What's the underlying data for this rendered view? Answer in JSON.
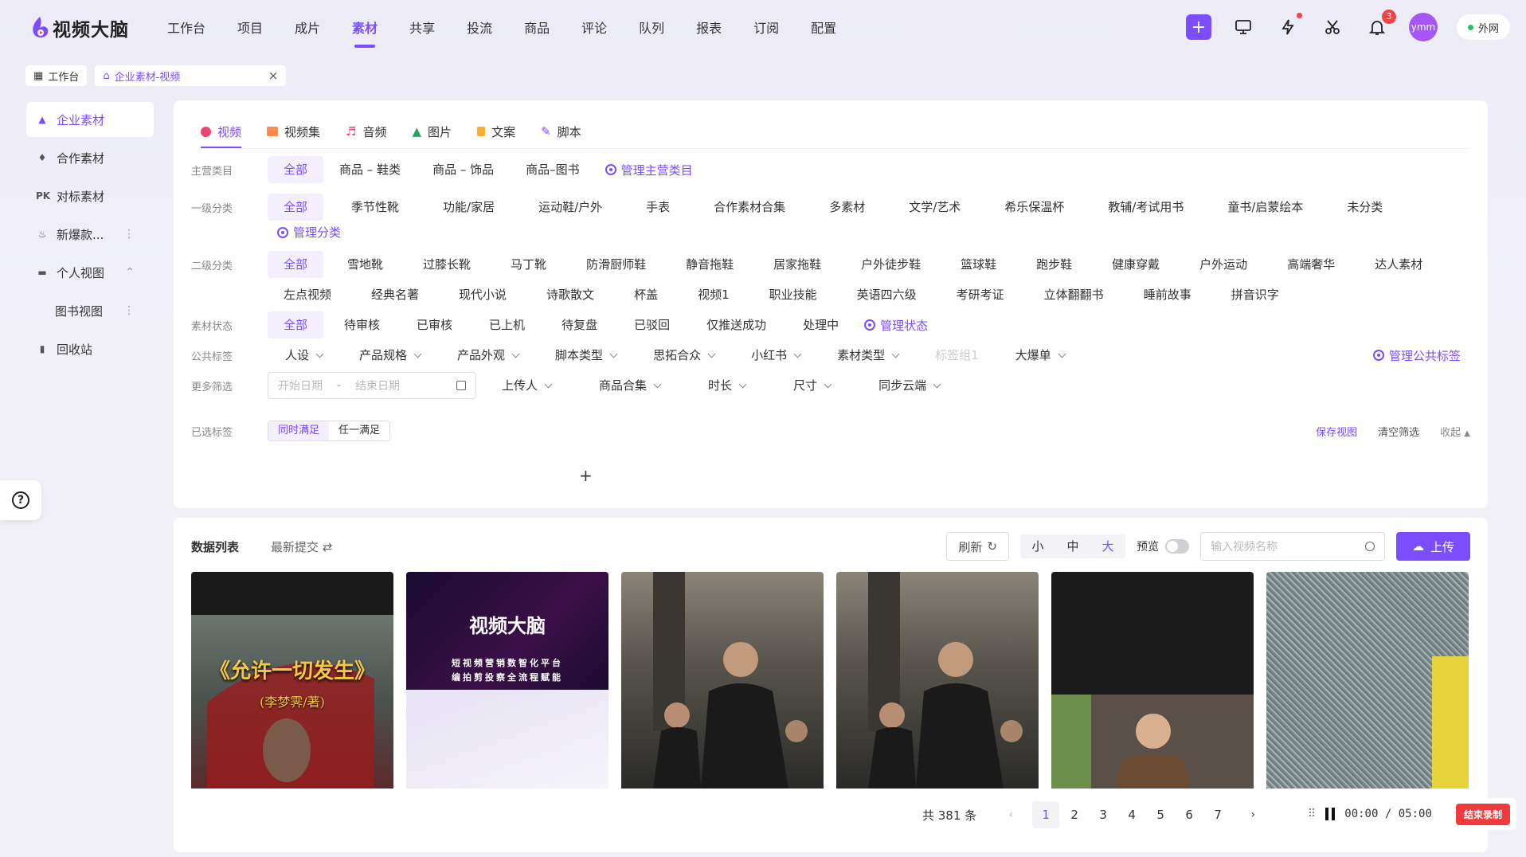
{
  "app": {
    "name": "视频大脑"
  },
  "nav": [
    "工作台",
    "项目",
    "成片",
    "素材",
    "共享",
    "投流",
    "商品",
    "评论",
    "队列",
    "报表",
    "订阅",
    "配置"
  ],
  "nav_active_index": 3,
  "toolbar": {
    "notification_count": "3",
    "avatar_text": "ymm",
    "network_label": "外网"
  },
  "page_tabs": [
    {
      "label": "工作台"
    },
    {
      "label": "企业素材-视频"
    }
  ],
  "sidebar": {
    "items": [
      {
        "label": "企业素材",
        "icon": "building-icon"
      },
      {
        "label": "合作素材",
        "icon": "handshake-icon"
      },
      {
        "label": "对标素材",
        "icon": "pk-icon"
      },
      {
        "label": "新爆款...",
        "icon": "fire-icon"
      },
      {
        "label": "个人视图",
        "icon": "folder-icon"
      },
      {
        "label": "图书视图",
        "icon": ""
      },
      {
        "label": "回收站",
        "icon": "trash-icon"
      }
    ]
  },
  "media_tabs": [
    "视频",
    "视频集",
    "音频",
    "图片",
    "文案",
    "脚本"
  ],
  "filters": {
    "main_category": {
      "label": "主营类目",
      "options": [
        "全部",
        "商品 – 鞋类",
        "商品 – 饰品",
        "商品–图书"
      ],
      "manage": "管理主营类目"
    },
    "level1": {
      "label": "一级分类",
      "options": [
        "全部",
        "季节性靴",
        "功能/家居",
        "运动鞋/户外",
        "手表",
        "合作素材合集",
        "多素材",
        "文学/艺术",
        "希乐保温杯",
        "教辅/考试用书",
        "童书/启蒙绘本",
        "未分类"
      ],
      "manage": "管理分类"
    },
    "level2": {
      "label": "二级分类",
      "row1": [
        "全部",
        "雪地靴",
        "过膝长靴",
        "马丁靴",
        "防滑厨师鞋",
        "静音拖鞋",
        "居家拖鞋",
        "户外徒步鞋",
        "篮球鞋",
        "跑步鞋",
        "健康穿戴",
        "户外运动",
        "高端奢华",
        "达人素材"
      ],
      "row2": [
        "左点视频",
        "经典名著",
        "现代小说",
        "诗歌散文",
        "杯盖",
        "视频1",
        "职业技能",
        "英语四六级",
        "考研考证",
        "立体翻翻书",
        "睡前故事",
        "拼音识字"
      ]
    },
    "status": {
      "label": "素材状态",
      "options": [
        "全部",
        "待审核",
        "已审核",
        "已上机",
        "待复盘",
        "已驳回",
        "仅推送成功",
        "处理中"
      ],
      "manage": "管理状态"
    },
    "public_tags": {
      "label": "公共标签",
      "options": [
        "人设",
        "产品规格",
        "产品外观",
        "脚本类型",
        "思拓合众",
        "小红书",
        "素材类型",
        "标签组1",
        "大爆单"
      ],
      "manage": "管理公共标签"
    },
    "more": {
      "label": "更多筛选",
      "start_placeholder": "开始日期",
      "sep": "-",
      "end_placeholder": "结束日期",
      "options": [
        "上传人",
        "商品合集",
        "时长",
        "尺寸",
        "同步云端"
      ]
    },
    "selected": {
      "label": "已选标签",
      "mode_all": "同时满足",
      "mode_any": "任一满足",
      "save_view": "保存视图",
      "clear": "清空筛选",
      "collapse": "收起"
    }
  },
  "list": {
    "title": "数据列表",
    "sort": "最新提交",
    "refresh": "刷新",
    "sizes": [
      "小",
      "中",
      "大"
    ],
    "preview_label": "预览",
    "search_placeholder": "输入视频名称",
    "upload": "上传",
    "thumbnails": [
      {
        "title": "《允许一切发生》",
        "subtitle": "(李梦霁/著)"
      },
      {
        "title": "视频大脑",
        "subtitle": "短视频营销数智化平台",
        "subtitle2": "编拍剪投察全流程赋能"
      },
      {
        "title": ""
      },
      {
        "title": ""
      },
      {
        "title": ""
      },
      {
        "title": ""
      }
    ],
    "total": "共 381 条",
    "pages": [
      "1",
      "2",
      "3",
      "4",
      "5",
      "6",
      "7"
    ]
  },
  "recorder": {
    "time": "00:00",
    "sep": "/",
    "duration": "05:00",
    "stop": "结束录制"
  }
}
